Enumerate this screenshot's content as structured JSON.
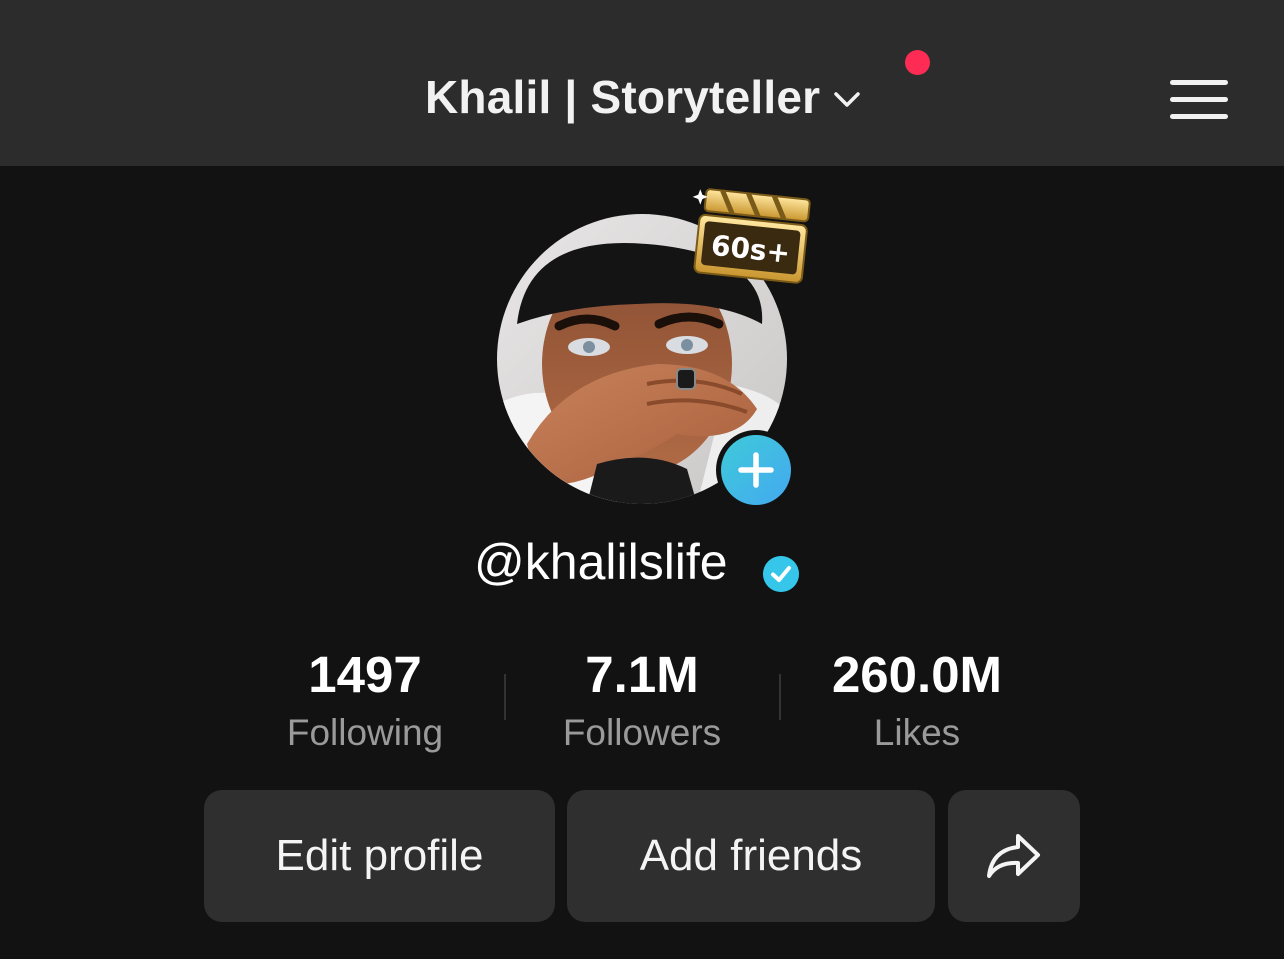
{
  "header": {
    "account_name": "Khalil | Storyteller",
    "has_notification": true
  },
  "profile": {
    "username": "@khalilslife",
    "verified": true,
    "avatar_badge": "60s+"
  },
  "stats": [
    {
      "value": "1497",
      "label": "Following"
    },
    {
      "value": "7.1M",
      "label": "Followers"
    },
    {
      "value": "260.0M",
      "label": "Likes"
    }
  ],
  "buttons": {
    "edit_profile": "Edit profile",
    "add_friends": "Add friends"
  },
  "icons": {
    "chevron": "chevron-down-icon",
    "menu": "hamburger-menu-icon",
    "add": "plus-icon",
    "verified": "verified-check-icon",
    "share": "share-arrow-icon"
  },
  "colors": {
    "header_bg": "#2c2c2c",
    "page_bg": "#121212",
    "notification": "#fe2c55",
    "verified": "#20d5ec",
    "button_bg": "#2f2f2f"
  }
}
